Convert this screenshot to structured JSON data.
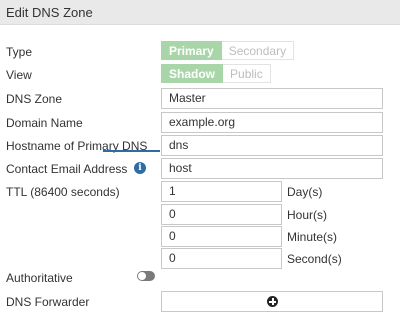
{
  "header": {
    "title": "Edit DNS Zone"
  },
  "type": {
    "label": "Type",
    "options": [
      "Primary",
      "Secondary"
    ],
    "selected": "Primary"
  },
  "view": {
    "label": "View",
    "options": [
      "Shadow",
      "Public"
    ],
    "selected": "Shadow"
  },
  "dns_zone": {
    "label": "DNS Zone",
    "value": "Master"
  },
  "domain_name": {
    "label": "Domain Name",
    "value": "example.org"
  },
  "primary_dns": {
    "label": "Hostname of Primary DNS",
    "value": "dns"
  },
  "contact_email": {
    "label": "Contact Email Address",
    "value": "host",
    "icon": "info-icon"
  },
  "ttl": {
    "label": "TTL (86400 seconds)",
    "days": {
      "value": "1",
      "unit": "Day(s)"
    },
    "hours": {
      "value": "0",
      "unit": "Hour(s)"
    },
    "minutes": {
      "value": "0",
      "unit": "Minute(s)"
    },
    "seconds": {
      "value": "0",
      "unit": "Second(s)"
    }
  },
  "authoritative": {
    "label": "Authoritative",
    "enabled": false
  },
  "dns_forwarder": {
    "label": "DNS Forwarder",
    "icon": "plus-circle-icon"
  },
  "colors": {
    "accent_active": "#a9d6a9",
    "info_blue": "#2e6da4"
  }
}
